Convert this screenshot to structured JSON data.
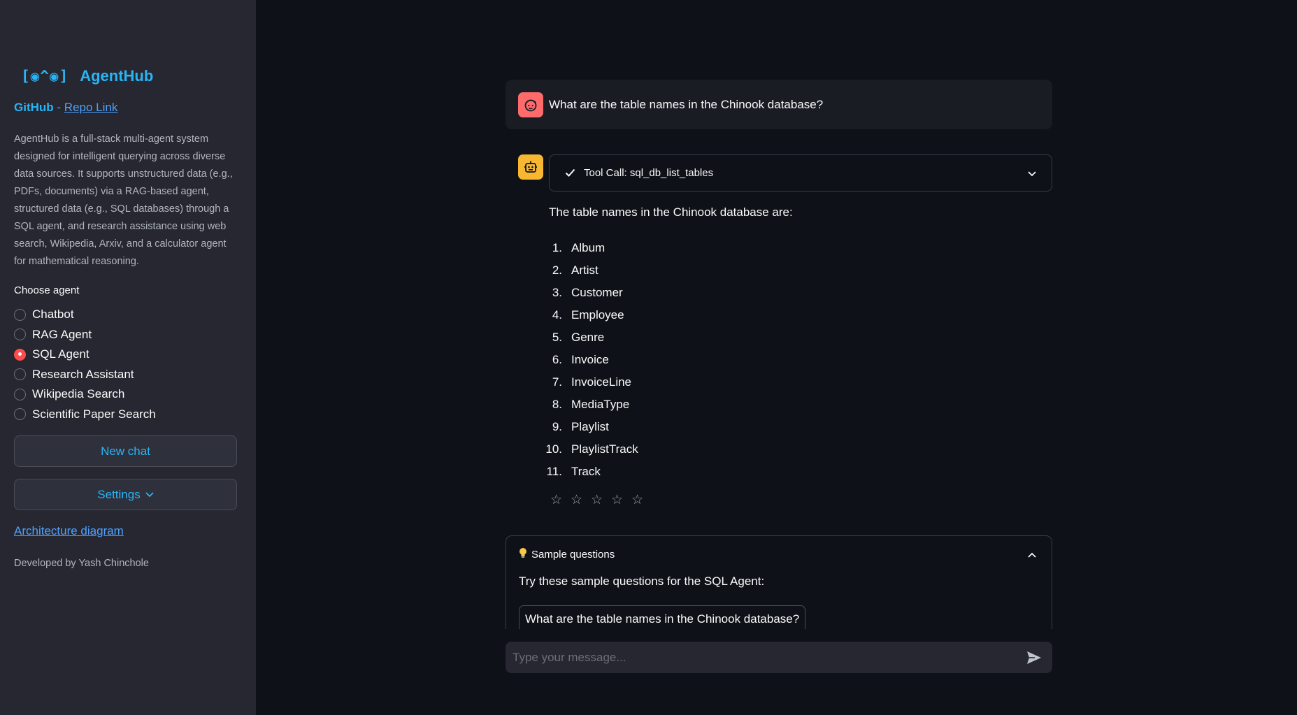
{
  "sidebar": {
    "logo_text": "[◉^◉]",
    "app_name": "AgentHub",
    "github_label": "GitHub",
    "separator": "-",
    "repo_link": "Repo Link",
    "description": "AgentHub is a full-stack multi-agent system designed for intelligent querying across diverse data sources. It supports unstructured data (e.g., PDFs, documents) via a RAG-based agent, structured data (e.g., SQL databases) through a SQL agent, and research assistance using web search, Wikipedia, Arxiv, and a calculator agent for mathematical reasoning.",
    "choose_label": "Choose agent",
    "agents": [
      {
        "label": "Chatbot",
        "selected": false
      },
      {
        "label": "RAG Agent",
        "selected": false
      },
      {
        "label": "SQL Agent",
        "selected": true
      },
      {
        "label": "Research Assistant",
        "selected": false
      },
      {
        "label": "Wikipedia Search",
        "selected": false
      },
      {
        "label": "Scientific Paper Search",
        "selected": false
      }
    ],
    "new_chat_label": "New chat",
    "settings_label": "Settings",
    "architecture_link": "Architecture diagram",
    "developer": "Developed by Yash Chinchole"
  },
  "chat": {
    "user_message": "What are the table names in the Chinook database?",
    "tool_call_label": "Tool Call: sql_db_list_tables",
    "answer_intro": "The table names in the Chinook database are:",
    "tables": [
      {
        "num": "1.",
        "name": "Album"
      },
      {
        "num": "2.",
        "name": "Artist"
      },
      {
        "num": "3.",
        "name": "Customer"
      },
      {
        "num": "4.",
        "name": "Employee"
      },
      {
        "num": "5.",
        "name": "Genre"
      },
      {
        "num": "6.",
        "name": "Invoice"
      },
      {
        "num": "7.",
        "name": "InvoiceLine"
      },
      {
        "num": "8.",
        "name": "MediaType"
      },
      {
        "num": "9.",
        "name": "Playlist"
      },
      {
        "num": "10.",
        "name": "PlaylistTrack"
      },
      {
        "num": "11.",
        "name": "Track"
      }
    ],
    "rating_stars": 5,
    "rating_value": 0
  },
  "sample": {
    "title": "Sample questions",
    "intro": "Try these sample questions for the SQL Agent:",
    "questions": [
      "What are the table names in the Chinook database?"
    ]
  },
  "input": {
    "placeholder": "Type your message..."
  },
  "colors": {
    "accent": "#29b5f5",
    "radio_selected": "#ff4b4b",
    "user_avatar": "#ff6b6b",
    "bot_avatar": "#f7b731",
    "background": "#0e1117",
    "sidebar": "#262730"
  },
  "icons": {
    "user_avatar": "face-icon",
    "bot_avatar": "robot-icon",
    "tool_status": "check-icon",
    "sample_bulb": "lightbulb-icon",
    "send": "send-icon"
  }
}
